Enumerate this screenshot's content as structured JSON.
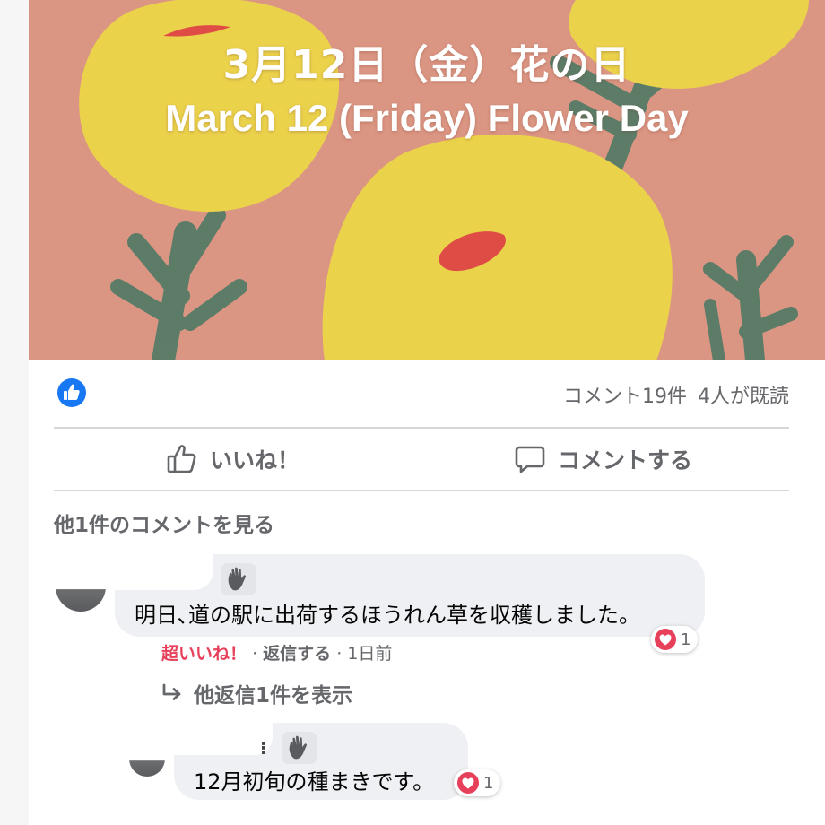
{
  "post": {
    "banner": {
      "title_jp": "3月12日（金）花の日",
      "title_en": "March 12 (Friday) Flower Day",
      "background_color": "#db9683",
      "flower_color": "#ebd24b",
      "leaf_color": "#4f7a66",
      "accent_color": "#df4b45"
    },
    "stats": {
      "reaction_icon": "like-thumb-icon",
      "comments": "コメント19件",
      "seen": "4人が既読"
    },
    "actions": {
      "like_label": "いいね！",
      "comment_label": "コメントする"
    },
    "view_more_comments": "他1件のコメントを見る",
    "comments": [
      {
        "text": "明日､道の駅に出荷するほうれん草を収穫しました。",
        "reaction_count": "1",
        "reaction_label": "超いいね！",
        "reply_label": "返信する",
        "time": "1日前",
        "view_replies": "他返信1件を表示"
      },
      {
        "text": "12月初旬の種まきです。",
        "reaction_count": "1",
        "dots": "⁝"
      }
    ],
    "colors": {
      "brand_blue": "#1877f2",
      "love_red": "#e7405b",
      "muted_text": "#65676b",
      "bubble_bg": "#eff0f3"
    }
  }
}
